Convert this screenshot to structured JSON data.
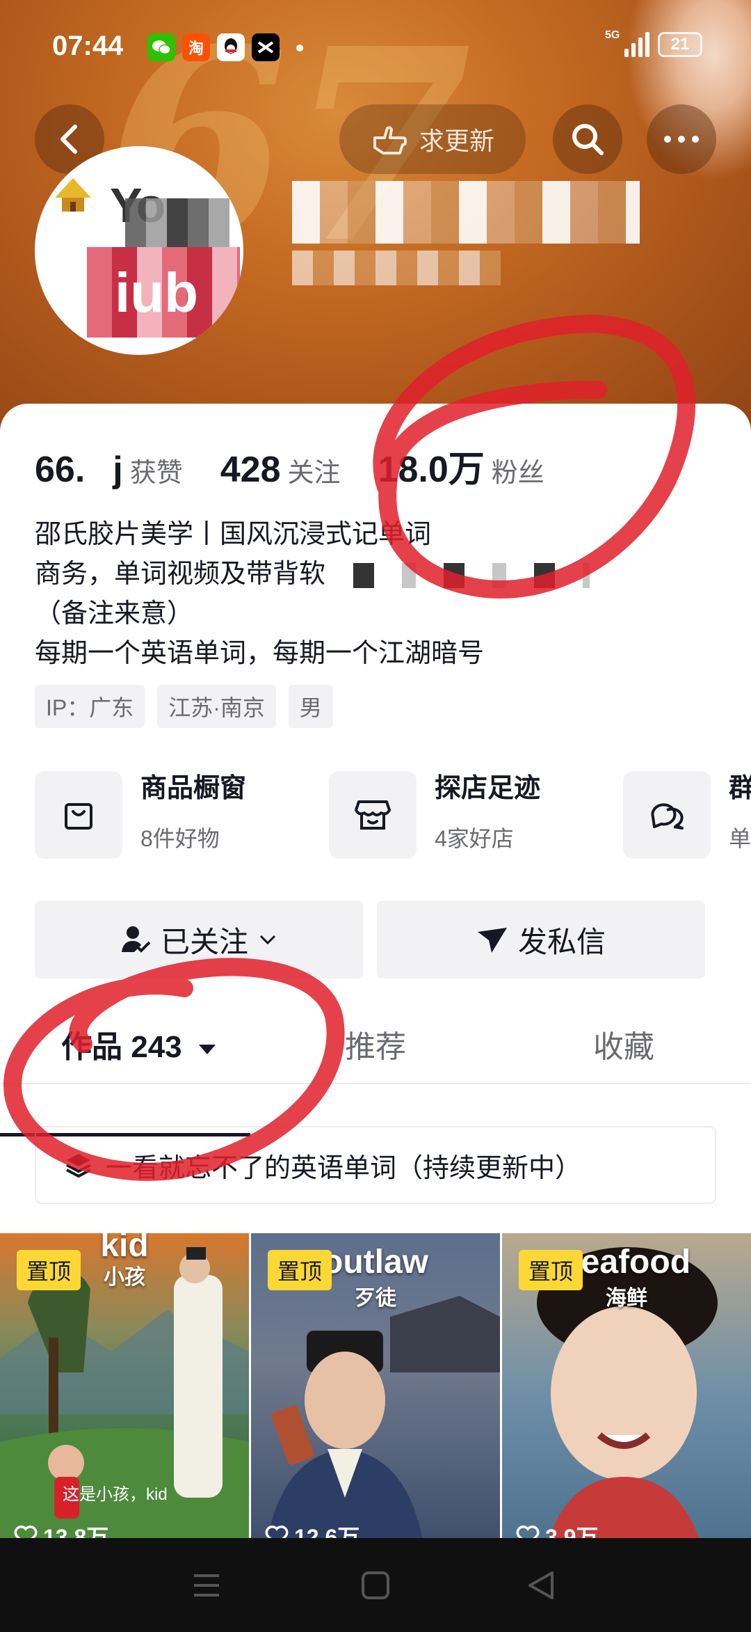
{
  "status_bar": {
    "time": "07:44",
    "apps": [
      "wechat-icon",
      "taobao-icon",
      "qq-icon",
      "capcut-icon"
    ],
    "taobao_label": "淘",
    "network": "5G",
    "battery": "21"
  },
  "header": {
    "back_icon": "back-arrow-icon",
    "update_label": "求更新",
    "search_icon": "search-icon",
    "more_icon": "more-icon"
  },
  "stats": {
    "likes_value": "66.",
    "likes_label": "获赞",
    "following_value": "428",
    "following_label": "关注",
    "followers_value": "18.0万",
    "followers_label": "粉丝"
  },
  "bio": {
    "line1": "邵氏胶片美学丨国风沉浸式记单词",
    "line2": "商务，单词视频及带背软",
    "line3": "（备注来意）",
    "line4": "每期一个英语单词，每期一个江湖暗号"
  },
  "tags": [
    "IP：广东",
    "江苏·南京",
    "男"
  ],
  "shortcuts": [
    {
      "title": "商品橱窗",
      "sub": "8件好物",
      "icon": "shopping-bag-icon"
    },
    {
      "title": "探店足迹",
      "sub": "4家好店",
      "icon": "store-icon"
    },
    {
      "title": "群",
      "sub": "单",
      "icon": "group-chat-icon"
    }
  ],
  "actions": {
    "follow_label": "已关注",
    "message_label": "发私信"
  },
  "tabs": {
    "works": "作品 243",
    "recommend": "推荐",
    "favorites": "收藏"
  },
  "collection": {
    "label": "一看就忘不了的英语单词（持续更新中）"
  },
  "videos": [
    {
      "pin": "置顶",
      "word": "kid",
      "meaning": "小孩",
      "caption": "这是小孩，kid",
      "likes": "13.8万"
    },
    {
      "pin": "置顶",
      "word": "outlaw",
      "meaning": "歹徒",
      "caption": "",
      "likes": "12.6万"
    },
    {
      "pin": "置顶",
      "word": "seafood",
      "meaning": "海鲜",
      "caption": "",
      "likes": "3.9万"
    }
  ],
  "colors": {
    "banner": "#c46a22",
    "pin_badge": "#fdd835",
    "annotation": "#e0202a",
    "text_primary": "#161823",
    "text_secondary": "#6a6b72"
  }
}
